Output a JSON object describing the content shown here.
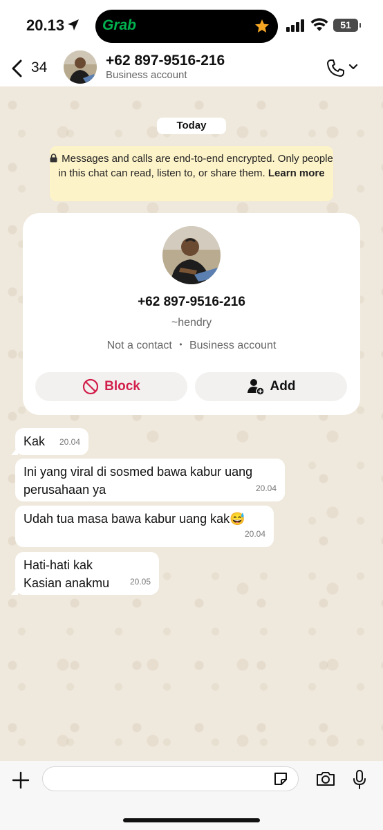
{
  "status_bar": {
    "time": "20.13",
    "island_app": "Grab",
    "battery": "51",
    "icons": [
      "location-arrow-icon",
      "star-icon",
      "signal-icon",
      "wifi-icon",
      "battery-icon"
    ]
  },
  "header": {
    "back_count": "34",
    "title": "+62 897-9516-216",
    "subtitle": "Business account"
  },
  "chat": {
    "date_chip": "Today",
    "encryption": {
      "text": "Messages and calls are end-to-end encrypted. Only people in this chat can read, listen to, or share them.",
      "link": "Learn more"
    },
    "profile_card": {
      "phone": "+62 897-9516-216",
      "push_name": "~hendry",
      "meta_left": "Not a contact",
      "meta_sep": "•",
      "meta_right": "Business account",
      "block_label": "Block",
      "add_label": "Add"
    },
    "messages": [
      {
        "line1": "Kak",
        "line2": "",
        "time": "20.04"
      },
      {
        "line1": "Ini yang viral di sosmed bawa kabur uang",
        "line2": "perusahaan ya",
        "time": "20.04"
      },
      {
        "line1": "Udah tua masa bawa kabur uang kak",
        "emoji": "😅",
        "line2": "",
        "time": "20.04"
      },
      {
        "line1": "Hati-hati kak",
        "line2": "Kasian anakmu",
        "time": "20.05"
      }
    ]
  },
  "composer": {
    "input_value": "",
    "placeholder": ""
  },
  "colors": {
    "block_red": "#d21e4a",
    "grab_green": "#00b14f",
    "banner_yellow": "#fdf3c9",
    "star_orange": "#f5a623"
  }
}
